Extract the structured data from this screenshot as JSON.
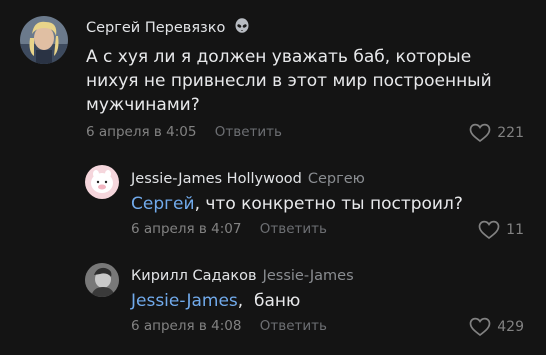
{
  "comments": [
    {
      "author": "Сергей Перевязко",
      "reply_to": "",
      "mention": "",
      "text": "А с хуя ли я должен уважать баб, которые нихуя не привнесли в этот мир построенный мужчинами?",
      "date": "6 апреля в 4:05",
      "reply_label": "Ответить",
      "likes": "221"
    },
    {
      "author": "Jessie-James Hollywood",
      "reply_to": "Сергею",
      "mention": "Сергей",
      "text": ", что конкретно ты построил?",
      "date": "6 апреля в 4:07",
      "reply_label": "Ответить",
      "likes": "11"
    },
    {
      "author": "Кирилл Садаков",
      "reply_to": "Jessie-James",
      "mention": "Jessie-James",
      "text": ",  баню",
      "date": "6 апреля в 4:08",
      "reply_label": "Ответить",
      "likes": "429"
    }
  ],
  "colors": {
    "background": "#141414",
    "mention": "#71aaeb",
    "meta": "#828282"
  },
  "icons": [
    "alien-emoji-icon",
    "heart-icon"
  ]
}
